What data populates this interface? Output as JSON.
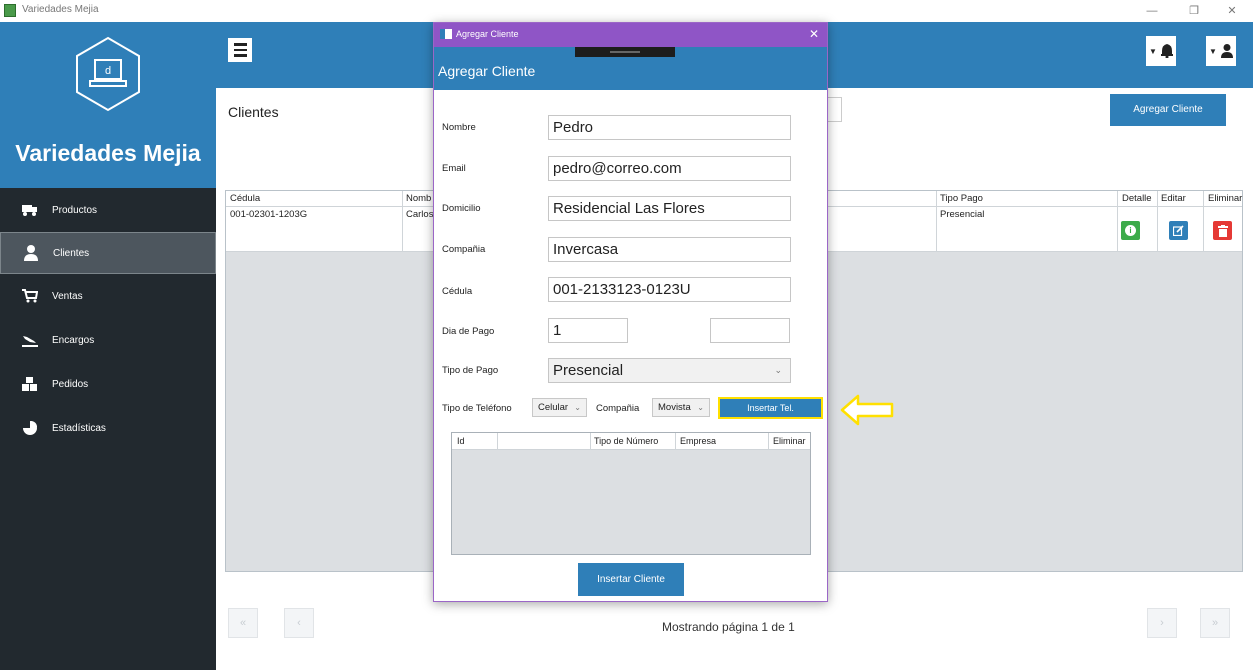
{
  "window": {
    "title": "Variedades Mejia",
    "controls": [
      "—",
      "❐",
      "✕"
    ]
  },
  "sidebar": {
    "brand_name": "Variedades Mejia",
    "brand_logo_letter": "d",
    "items": [
      {
        "label": "Productos",
        "icon": "truck-icon",
        "active": false
      },
      {
        "label": "Clientes",
        "icon": "user-icon",
        "active": true
      },
      {
        "label": "Ventas",
        "icon": "cart-icon",
        "active": false
      },
      {
        "label": "Encargos",
        "icon": "plane-landing-icon",
        "active": false
      },
      {
        "label": "Pedidos",
        "icon": "boxes-icon",
        "active": false
      },
      {
        "label": "Estadísticas",
        "icon": "pie-chart-icon",
        "active": false
      }
    ]
  },
  "header": {
    "icons": [
      "menu-icon",
      "bell-icon",
      "user-icon"
    ]
  },
  "main": {
    "title": "Clientes",
    "add_button": "Agregar Cliente",
    "table": {
      "headers": [
        "Cédula",
        "Nomb",
        "Tipo Pago",
        "Detalle",
        "Editar",
        "Eliminar"
      ],
      "rows": [
        {
          "cedula": "001-02301-1203G",
          "nombre": "Carlos",
          "tipo_pago": "Presencial"
        }
      ]
    },
    "pager": {
      "first": "«",
      "prev": "‹",
      "next": "›",
      "last": "»",
      "text": "Mostrando página 1 de 1"
    }
  },
  "modal": {
    "window_title": "Agregar Cliente",
    "close": "✕",
    "heading": "Agregar Cliente",
    "fields": {
      "nombre": {
        "label": "Nombre",
        "value": "Pedro"
      },
      "email": {
        "label": "Email",
        "value": "pedro@correo.com"
      },
      "domicilio": {
        "label": "Domicilio",
        "value": "Residencial Las Flores"
      },
      "compania": {
        "label": "Compañia",
        "value": "Invercasa"
      },
      "cedula": {
        "label": "Cédula",
        "value": "001-2133123-0123U"
      },
      "dia_pago": {
        "label": "Dia de Pago",
        "value": "1",
        "value2": ""
      },
      "tipo_pago": {
        "label": "Tipo de Pago",
        "value": "Presencial"
      }
    },
    "phone": {
      "type_label": "Tipo de Teléfono",
      "type_value": "Celular",
      "company_label": "Compañia",
      "company_value": "Movista",
      "insert_button": "Insertar Tel."
    },
    "phone_table": {
      "headers": [
        "Id",
        "Tipo de Número",
        "Empresa",
        "Eliminar"
      ]
    },
    "submit_button": "Insertar Cliente"
  },
  "colors": {
    "primary": "#2f7fb8",
    "sidebar": "#22292f",
    "modal_titlebar": "#8f55c6",
    "detail": "#3cab4a",
    "edit": "#2f7fb8",
    "delete": "#e53935",
    "highlight": "#ffe000"
  }
}
